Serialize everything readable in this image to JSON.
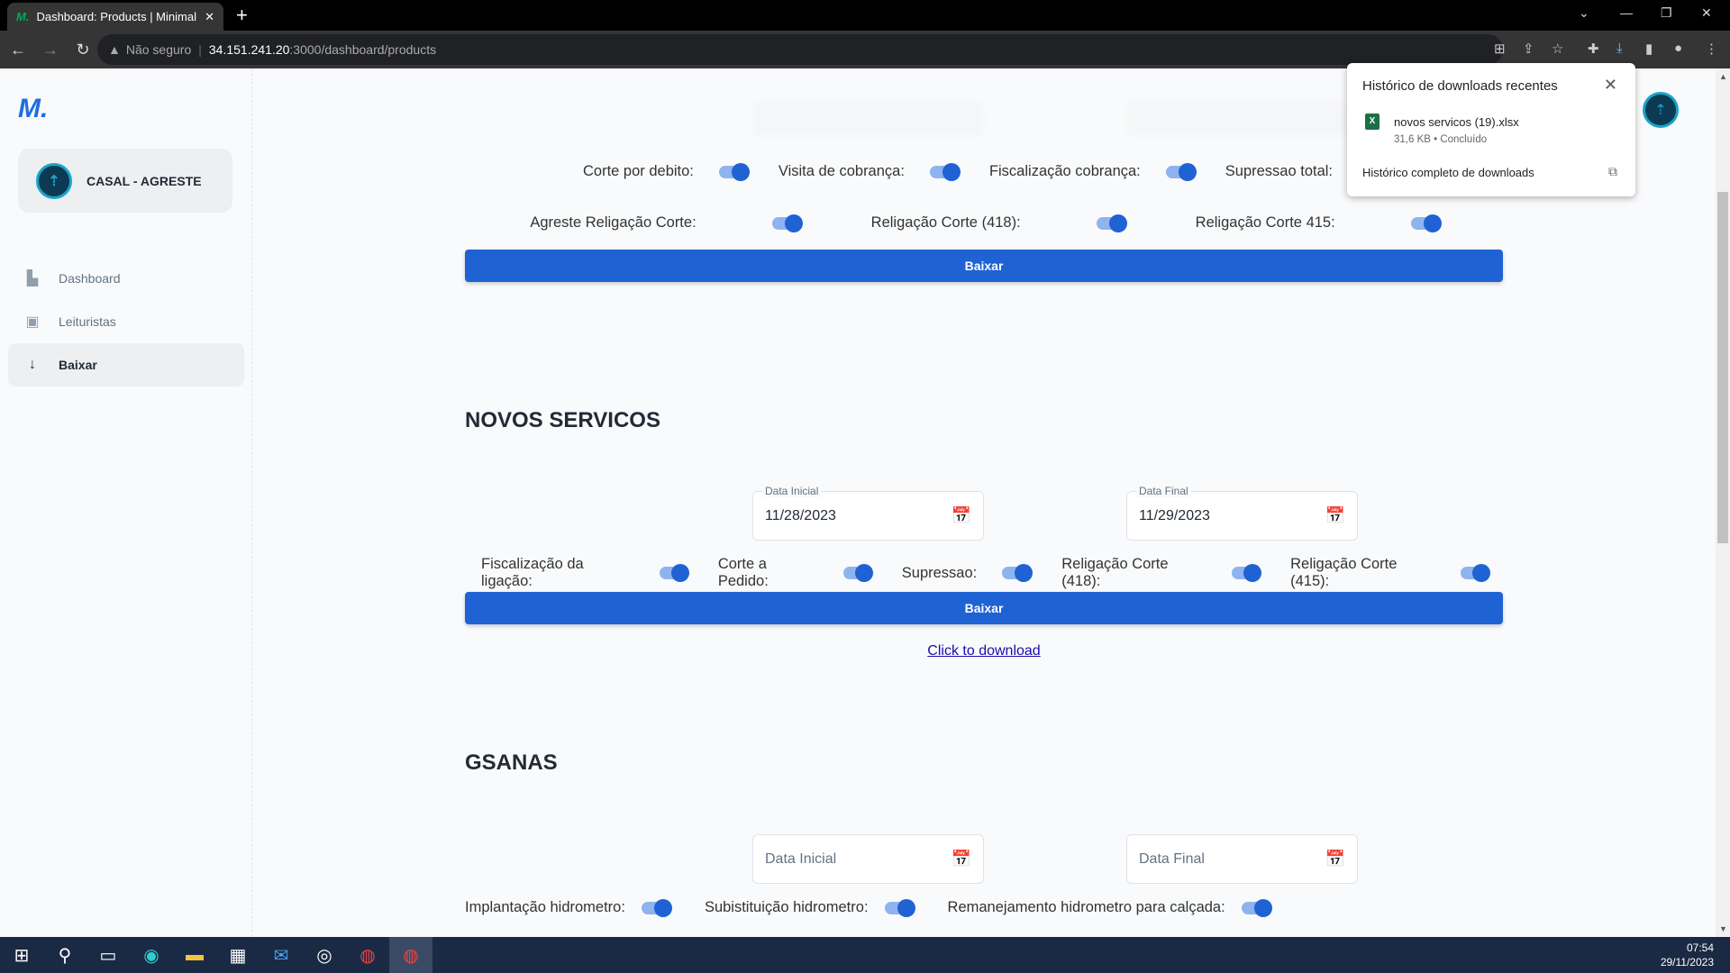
{
  "browser": {
    "tab_title": "Dashboard: Products | Minimal UI",
    "security": "Não seguro",
    "url_host": "34.151.241.20",
    "url_path": ":3000/dashboard/products"
  },
  "sidebar": {
    "org": "CASAL - AGRESTE",
    "items": [
      {
        "label": "Dashboard",
        "icon": "chart-icon"
      },
      {
        "label": "Leituristas",
        "icon": "user-icon"
      },
      {
        "label": "Baixar",
        "icon": "arrow-down-icon",
        "active": true
      }
    ]
  },
  "section1": {
    "toggles_row1": [
      "Corte por debito:",
      "Visita de cobrança:",
      "Fiscalização cobrança:",
      "Supressao total:"
    ],
    "toggles_row2": [
      "Agreste Religação Corte:",
      "Religação Corte (418):",
      "Religação Corte 415:"
    ],
    "button": "Baixar"
  },
  "novos": {
    "title": "NOVOS SERVICOS",
    "start_label": "Data Inicial",
    "start_value": "11/28/2023",
    "end_label": "Data Final",
    "end_value": "11/29/2023",
    "toggles": [
      "Fiscalização da ligação:",
      "Corte a Pedido:",
      "Supressao:",
      "Religação Corte (418):",
      "Religação Corte (415):"
    ],
    "button": "Baixar",
    "link": "Click to download"
  },
  "gsanas": {
    "title": "GSANAS",
    "start_placeholder": "Data Inicial",
    "end_placeholder": "Data Final",
    "toggles": [
      "Implantação hidrometro:",
      "Subistituição hidrometro:",
      "Remanejamento hidrometro para calçada:"
    ]
  },
  "downloads": {
    "title": "Histórico de downloads recentes",
    "file": "novos servicos (19).xlsx",
    "status": "31,6 KB • Concluído",
    "all": "Histórico completo de downloads"
  },
  "taskbar": {
    "time": "07:54",
    "date": "29/11/2023"
  }
}
